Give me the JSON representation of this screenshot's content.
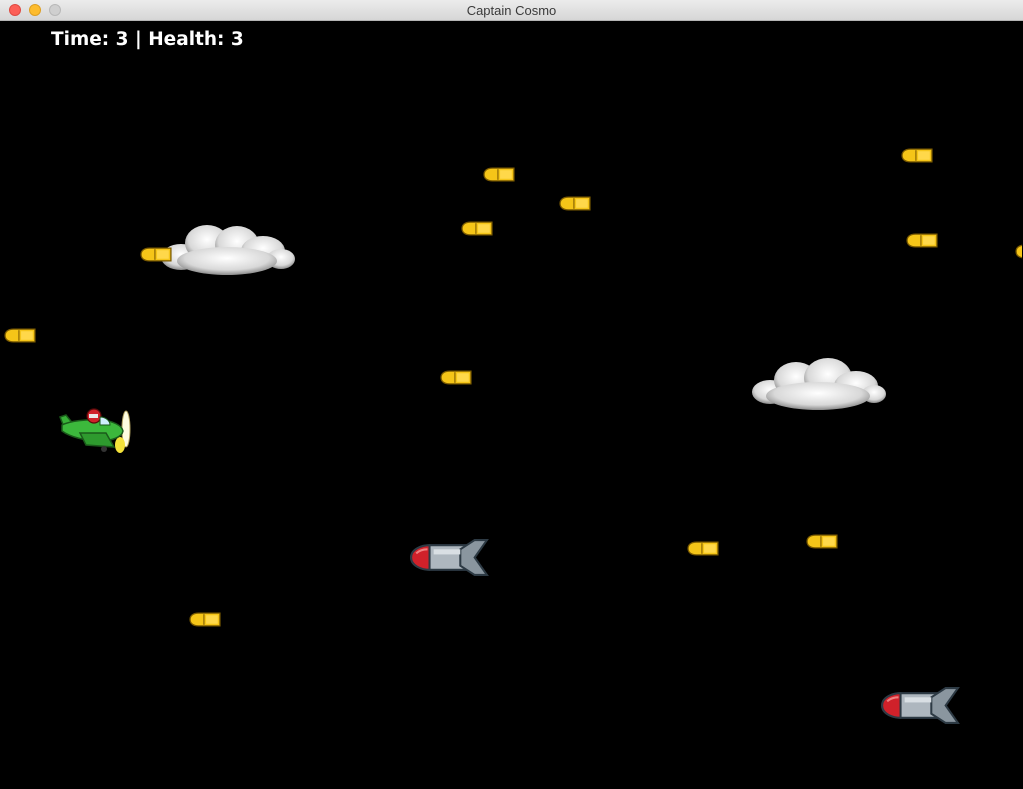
{
  "window": {
    "title": "Captain Cosmo"
  },
  "hud": {
    "time_label": "Time:",
    "time_value": "3",
    "separator": "|",
    "health_label": "Health:",
    "health_value": "3"
  },
  "colors": {
    "bullet": "#f5c518",
    "missile_tip": "#d0212a",
    "plane": "#2ea82e",
    "background": "#000000"
  },
  "sprites": {
    "player": "green-airplane-with-pilot",
    "enemy_bullet": "yellow-bullet",
    "enemy_missile": "grey-missile-red-tip",
    "cloud": "white-cloud"
  },
  "counts": {
    "bullets": 13,
    "missiles": 2,
    "clouds": 2
  }
}
